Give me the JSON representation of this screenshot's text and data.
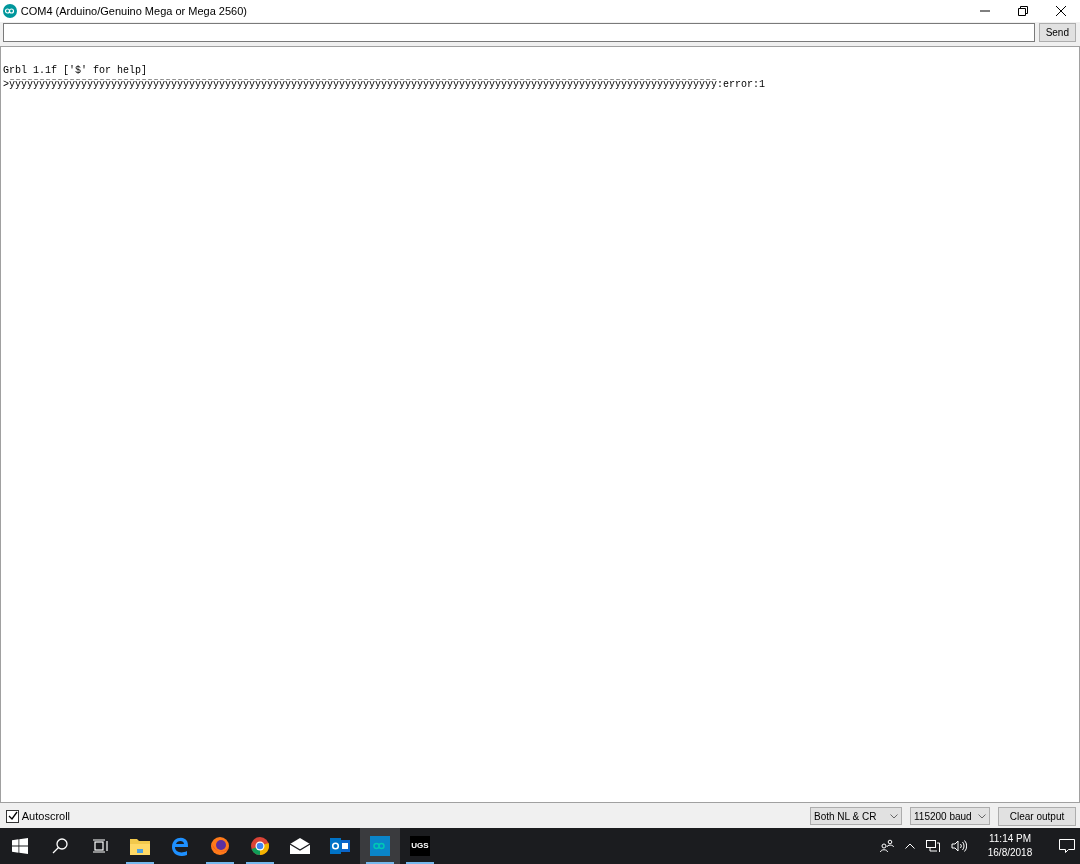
{
  "window": {
    "title": "COM4 (Arduino/Genuino Mega or Mega 2560)"
  },
  "send_button": "Send",
  "output_lines": [
    "Grbl 1.1f ['$' for help]",
    ">ÿÿÿÿÿÿÿÿÿÿÿÿÿÿÿÿÿÿÿÿÿÿÿÿÿÿÿÿÿÿÿÿÿÿÿÿÿÿÿÿÿÿÿÿÿÿÿÿÿÿÿÿÿÿÿÿÿÿÿÿÿÿÿÿÿÿÿÿÿÿÿÿÿÿÿÿÿÿÿÿÿÿÿÿÿÿÿÿÿÿÿÿÿÿÿÿÿÿÿÿÿÿÿÿÿÿÿÿÿÿÿÿÿÿÿÿÿÿ:error:1"
  ],
  "autoscroll": {
    "label": "Autoscroll",
    "checked": true
  },
  "line_ending": "Both NL & CR",
  "baud": "115200 baud",
  "clear_button": "Clear output",
  "taskbar": {
    "apps": [
      {
        "kind": "explorer",
        "running": true,
        "selected": false
      },
      {
        "kind": "edge",
        "running": false,
        "selected": false
      },
      {
        "kind": "firefox",
        "running": true,
        "selected": false
      },
      {
        "kind": "chrome",
        "running": true,
        "selected": false
      },
      {
        "kind": "mail",
        "running": false,
        "selected": false
      },
      {
        "kind": "outlook",
        "running": false,
        "selected": false
      },
      {
        "kind": "arduino",
        "running": true,
        "selected": true
      },
      {
        "kind": "ugs",
        "running": true,
        "selected": false,
        "label": "UGS"
      }
    ],
    "time": "11:14 PM",
    "date": "16/8/2018"
  }
}
